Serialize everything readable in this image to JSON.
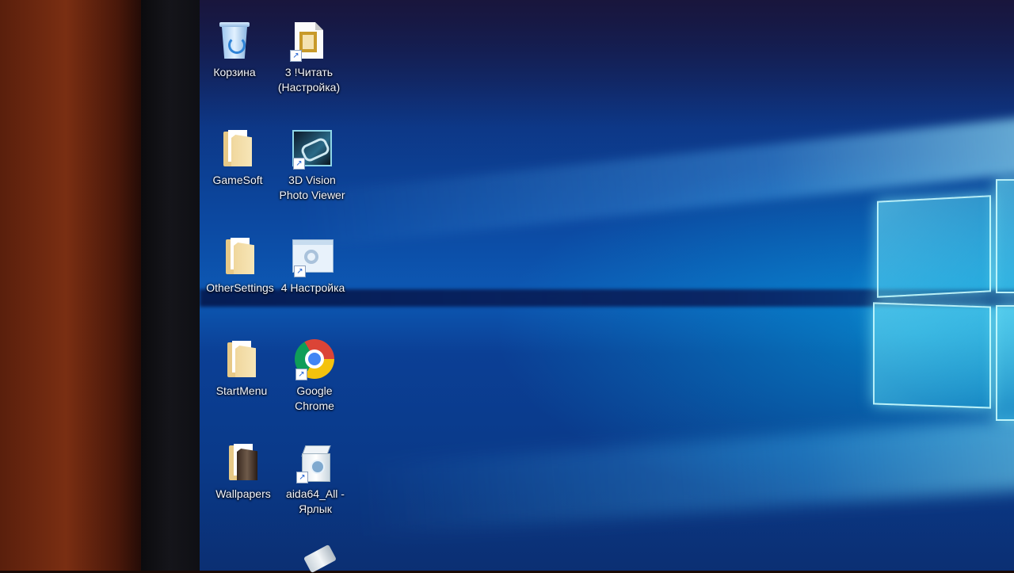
{
  "desktop": {
    "icons": [
      {
        "label": "Корзина",
        "icon": "recycle-bin-icon",
        "shortcut": false
      },
      {
        "label": "3 !Читать\n(Настройка)",
        "icon": "document-shortcut-icon",
        "shortcut": true
      },
      {
        "label": "GameSoft",
        "icon": "folder-icon",
        "shortcut": false
      },
      {
        "label": "3D Vision\nPhoto Viewer",
        "icon": "3d-vision-icon",
        "shortcut": true
      },
      {
        "label": "OtherSettings",
        "icon": "folder-icon",
        "shortcut": false
      },
      {
        "label": "4 Настройка",
        "icon": "window-screenshot-icon",
        "shortcut": true
      },
      {
        "label": "StartMenu",
        "icon": "folder-icon",
        "shortcut": false
      },
      {
        "label": "Google\nChrome",
        "icon": "chrome-icon",
        "shortcut": true
      },
      {
        "label": "Wallpapers",
        "icon": "folder-icon",
        "shortcut": false
      },
      {
        "label": "aida64_All -\nЯрлык",
        "icon": "installer-icon",
        "shortcut": true
      }
    ]
  },
  "colors": {
    "wallpaper_dark": "#0b2f73",
    "wallpaper_mid": "#0c4aa3",
    "wallpaper_glow": "#7ff4ff",
    "icon_label": "#f3f6ff",
    "wall": "#7a2e12"
  }
}
